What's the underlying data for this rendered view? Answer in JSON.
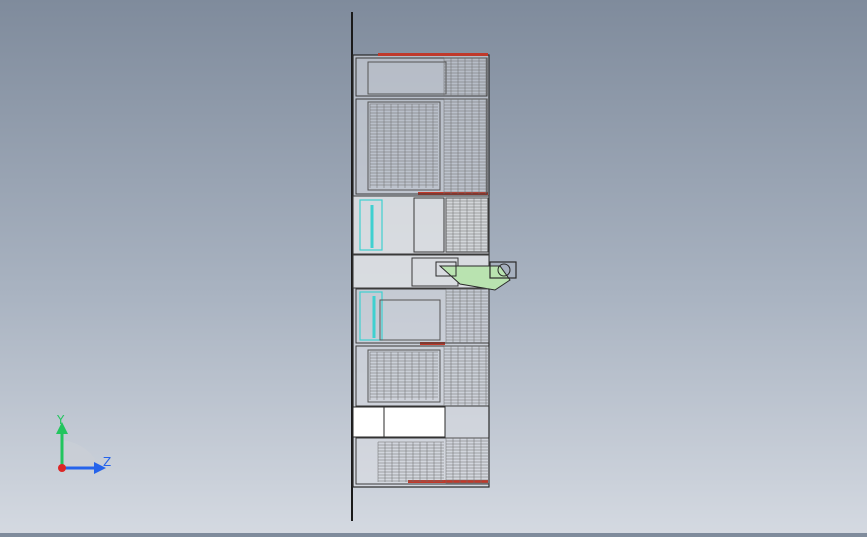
{
  "window": {
    "title": ""
  },
  "view": {
    "background_top": "#7f8b9c",
    "background_bottom": "#d4d9e1"
  },
  "model": {
    "line_color": "#2a2a2a",
    "hatch_color": "#6c6c6c",
    "accent_red": "#c0392b",
    "accent_cyan": "#3fd0d0",
    "accent_green": "#b9e3b0"
  },
  "triad": {
    "y_label": "Y",
    "z_label": "Z",
    "y_color": "#22c55e",
    "z_color": "#2563eb",
    "x_color": "#dc2626"
  }
}
